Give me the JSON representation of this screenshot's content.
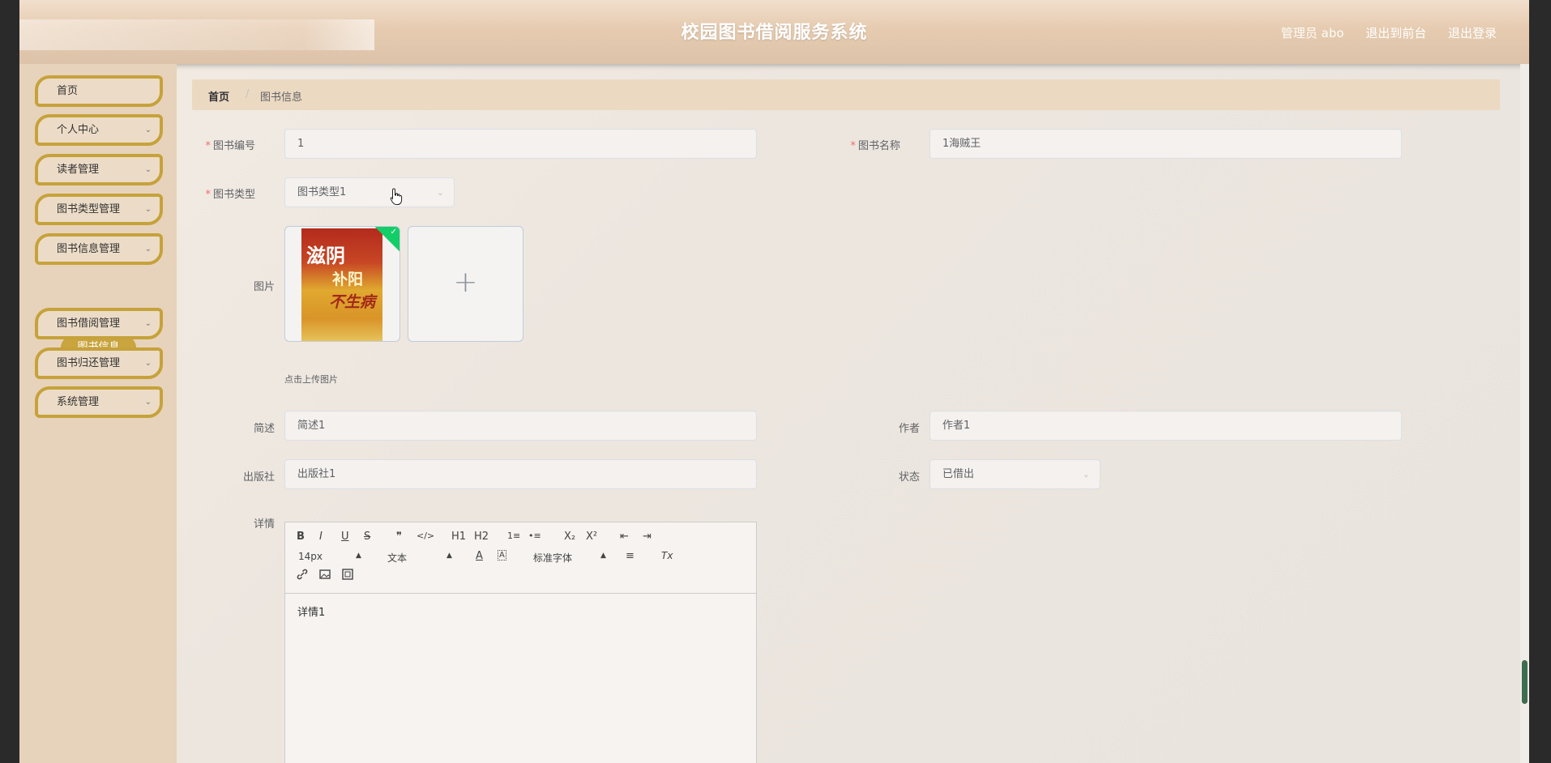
{
  "header": {
    "title": "校园图书借阅服务系统",
    "user_label": "管理员 abo",
    "front_link": "退出到前台",
    "logout_link": "退出登录"
  },
  "sidebar": {
    "items": [
      {
        "label": "首页",
        "has_children": false
      },
      {
        "label": "个人中心",
        "has_children": true
      },
      {
        "label": "读者管理",
        "has_children": true
      },
      {
        "label": "图书类型管理",
        "has_children": true
      },
      {
        "label": "图书信息管理",
        "has_children": true
      },
      {
        "label": "图书借阅管理",
        "has_children": true
      },
      {
        "label": "图书归还管理",
        "has_children": true
      },
      {
        "label": "系统管理",
        "has_children": true
      }
    ],
    "active_sub": "图书信息"
  },
  "breadcrumb": {
    "home": "首页",
    "separator": "/",
    "current": "图书信息"
  },
  "form": {
    "book_no": {
      "label": "图书编号",
      "value": "1",
      "required": true
    },
    "book_name": {
      "label": "图书名称",
      "value": "1海贼王",
      "required": true
    },
    "book_type": {
      "label": "图书类型",
      "value": "图书类型1",
      "required": true
    },
    "image": {
      "label": "图片",
      "tip": "点击上传图片"
    },
    "summary": {
      "label": "简述",
      "value": "简述1"
    },
    "author": {
      "label": "作者",
      "value": "作者1"
    },
    "publisher": {
      "label": "出版社",
      "value": "出版社1"
    },
    "status": {
      "label": "状态",
      "value": "已借出"
    },
    "details": {
      "label": "详情",
      "content": "详情1"
    }
  },
  "book_cover": {
    "line1": "滋阴",
    "line2": "补阳",
    "line3": "不生病"
  },
  "editor_toolbar": {
    "row1": [
      "B",
      "I",
      "U",
      "S",
      "❞",
      "</>",
      "H1",
      "H2",
      "1≡",
      "•≡",
      "X₂",
      "X²",
      "⇤",
      "⇥"
    ],
    "font_size": "14px",
    "header_select": "文本",
    "font_family": "标准字体",
    "text_color": "A",
    "bg_color": "A",
    "align": "≡",
    "clean": "Tx"
  },
  "colors": {
    "accent_gold": "#c6a23b",
    "required_red": "#f56c6c",
    "success_green": "#13ce66"
  }
}
